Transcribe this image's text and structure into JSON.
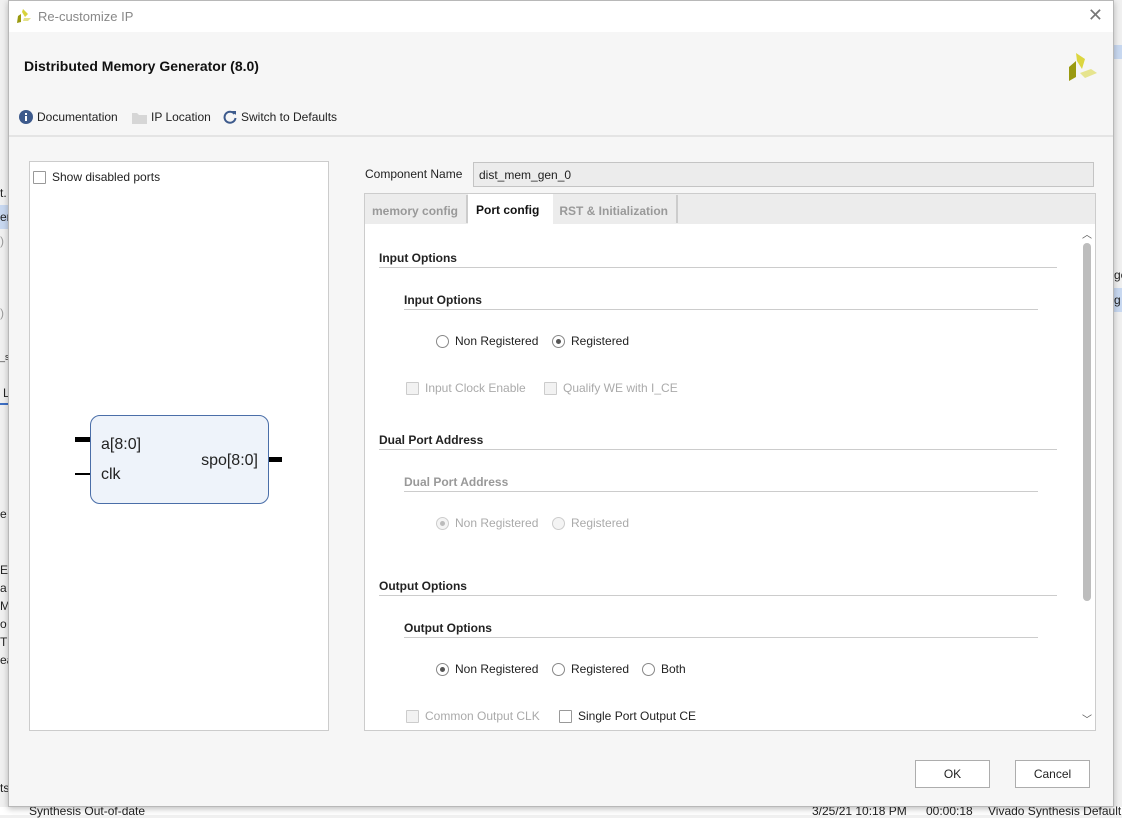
{
  "background": {
    "left_fragments": [
      "t.",
      "er",
      ")",
      ")",
      "_s",
      "L",
      "e",
      "E",
      "a",
      "M",
      "o",
      "T",
      "ea"
    ],
    "right_fragments": [
      "ge",
      "g"
    ],
    "status_row": {
      "name": "Synthesis Out-of-date",
      "time": "3/25/21 10:18 PM",
      "elapsed": "00:00:18",
      "strategy": "Vivado Synthesis Default"
    },
    "side_label": "ts"
  },
  "dialog": {
    "title": "Re-customize IP",
    "header": "Distributed Memory Generator (8.0)",
    "toolbar": {
      "documentation": "Documentation",
      "ip_location": "IP Location",
      "switch_defaults": "Switch to Defaults"
    },
    "left": {
      "show_disabled": "Show disabled ports",
      "ports_in": [
        "a[8:0]",
        "clk"
      ],
      "port_out": "spo[8:0]"
    },
    "component_name_label": "Component Name",
    "component_name_value": "dist_mem_gen_0",
    "tabs": [
      {
        "label": "memory config",
        "active": false
      },
      {
        "label": "Port config",
        "active": true
      },
      {
        "label": "RST & Initialization",
        "active": false
      }
    ],
    "input_options": {
      "section": "Input Options",
      "sub": "Input Options",
      "radios": [
        "Non Registered",
        "Registered"
      ],
      "selected": "Registered",
      "checkboxes": [
        "Input Clock Enable",
        "Qualify WE with I_CE"
      ]
    },
    "dual_port": {
      "section": "Dual Port Address",
      "sub": "Dual Port Address",
      "radios": [
        "Non Registered",
        "Registered"
      ],
      "selected": "Non Registered"
    },
    "output_options": {
      "section": "Output Options",
      "sub": "Output Options",
      "radios": [
        "Non Registered",
        "Registered",
        "Both"
      ],
      "selected": "Non Registered",
      "checkboxes": [
        "Common Output CLK",
        "Single Port Output CE"
      ]
    },
    "ok": "OK",
    "cancel": "Cancel"
  },
  "colors": {
    "accent": "#3d5a8c",
    "block_fill": "#eef3fa",
    "block_border": "#4a6ea8",
    "logo": "#c9c31e"
  }
}
